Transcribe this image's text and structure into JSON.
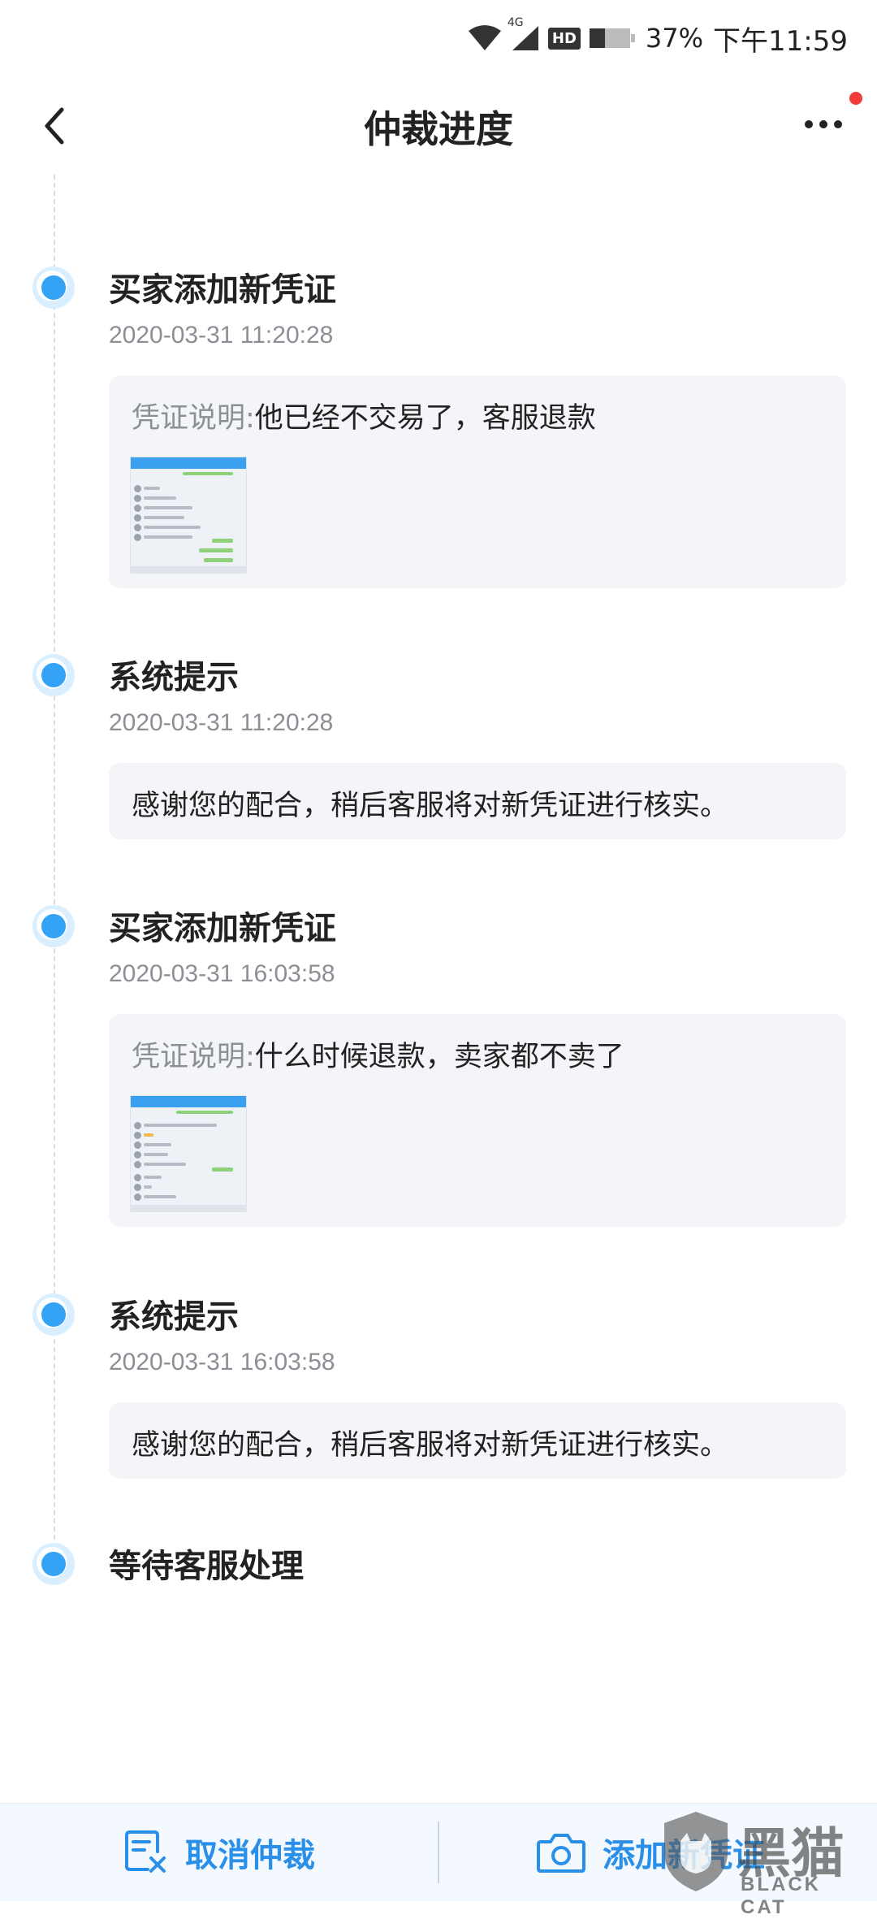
{
  "status_bar": {
    "network": "4G",
    "hd": "HD",
    "battery_percent": "37%",
    "time": "下午11:59"
  },
  "nav": {
    "title": "仲裁进度"
  },
  "events": [
    {
      "title": "买家添加新凭证",
      "time": "2020-03-31 11:20:28",
      "label": "凭证说明:",
      "text": "他已经不交易了，客服退款",
      "has_image": true
    },
    {
      "title": "系统提示",
      "time": "2020-03-31 11:20:28",
      "text": "感谢您的配合，稍后客服将对新凭证进行核实。"
    },
    {
      "title": "买家添加新凭证",
      "time": "2020-03-31 16:03:58",
      "label": "凭证说明:",
      "text": "什么时候退款，卖家都不卖了",
      "has_image": true
    },
    {
      "title": "系统提示",
      "time": "2020-03-31 16:03:58",
      "text": "感谢您的配合，稍后客服将对新凭证进行核实。"
    },
    {
      "title": "等待客服处理"
    }
  ],
  "bottom": {
    "cancel_label": "取消仲裁",
    "add_label": "添加新凭证"
  },
  "watermark": {
    "text": "黑猫",
    "sub": "BLACK CAT"
  },
  "colors": {
    "accent": "#35a3f5",
    "button_text": "#2a8fe8",
    "box_bg": "#f4f5f8",
    "badge": "#f23b3b"
  }
}
